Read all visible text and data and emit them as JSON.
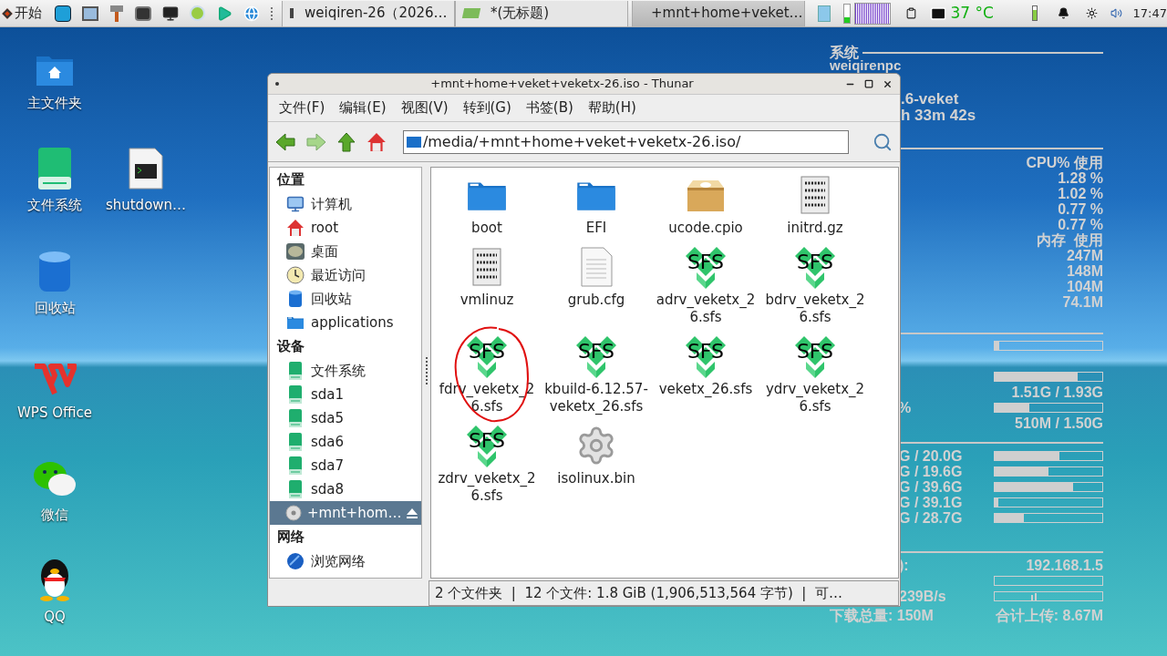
{
  "taskbar": {
    "start": {
      "label": "开始"
    },
    "tasks": [
      {
        "label": "weiqiren-26（2026…",
        "kind": "terminal",
        "selected": false
      },
      {
        "label": "*(无标题)",
        "kind": "editor",
        "selected": false
      },
      {
        "label": "+mnt+home+veket…",
        "kind": "filemanager",
        "selected": true
      }
    ],
    "temperature": "37 °C",
    "clock": "17:47"
  },
  "desktop_icons": [
    {
      "label": "主文件夹",
      "kind": "home"
    },
    {
      "label": "文件系统",
      "kind": "drive"
    },
    {
      "label": "shutdown…",
      "kind": "script"
    },
    {
      "label": "回收站",
      "kind": "trash"
    },
    {
      "label": "WPS Office",
      "kind": "wps"
    },
    {
      "label": "微信",
      "kind": "chat"
    },
    {
      "label": "QQ",
      "kind": "penguin"
    }
  ],
  "conky": {
    "header": "系统",
    "hostname": "weiqirenpc",
    "kernel": ".6-veket",
    "uptime": "h 33m 42s",
    "cpu_heading": "CPU% 使用",
    "cpu_values": [
      "1.28 %",
      "1.02 %",
      "0.77 %",
      "0.77 %"
    ],
    "mem_heading": "内存  使用",
    "mem_values": [
      "247M",
      "148M",
      "104M",
      "74.1M"
    ],
    "meters": [
      {
        "level": 0.04
      },
      {
        "level": 0.77,
        "reading": "1.51G / 1.93G"
      },
      {
        "label": "%",
        "level": 0.32,
        "reading": "510M / 1.50G"
      }
    ],
    "disks": [
      {
        "label": "G / 20.0G",
        "level": 0.6
      },
      {
        "label": "G / 19.6G",
        "level": 0.5
      },
      {
        "label": "G / 39.6G",
        "level": 0.73
      },
      {
        "label": "G / 39.1G",
        "level": 0.03
      },
      {
        "label": "G / 28.7G",
        "level": 0.27
      }
    ],
    "network": {
      "label": "):",
      "ip": "192.168.1.5",
      "speed": "239B/s",
      "download_total": "下载总量: 150M",
      "upload_total": "合计上传: 8.67M"
    }
  },
  "window": {
    "title": "+mnt+home+veket+veketx-26.iso - Thunar",
    "menu": [
      "文件(F)",
      "编辑(E)",
      "视图(V)",
      "转到(G)",
      "书签(B)",
      "帮助(H)"
    ],
    "location": "/media/+mnt+home+veket+veketx-26.iso/",
    "sidebar": [
      {
        "heading": "位置",
        "items": [
          {
            "label": "计算机",
            "kind": "computer",
            "selected": false
          },
          {
            "label": "root",
            "kind": "home",
            "selected": false
          },
          {
            "label": "桌面",
            "kind": "desktop",
            "selected": false
          },
          {
            "label": "最近访问",
            "kind": "recent",
            "selected": false
          },
          {
            "label": "回收站",
            "kind": "trash",
            "selected": false
          },
          {
            "label": "applications",
            "kind": "folder",
            "selected": false
          }
        ]
      },
      {
        "heading": "设备",
        "items": [
          {
            "label": "文件系统",
            "kind": "drive",
            "selected": false
          },
          {
            "label": "sda1",
            "kind": "drive",
            "selected": false
          },
          {
            "label": "sda5",
            "kind": "drive",
            "selected": false
          },
          {
            "label": "sda6",
            "kind": "drive",
            "selected": false
          },
          {
            "label": "sda7",
            "kind": "drive",
            "selected": false
          },
          {
            "label": "sda8",
            "kind": "drive",
            "selected": false
          },
          {
            "label": "+mnt+hom…",
            "kind": "disc",
            "selected": true
          }
        ]
      },
      {
        "heading": "网络",
        "items": [
          {
            "label": "浏览网络",
            "kind": "network",
            "selected": false
          }
        ]
      }
    ],
    "files": [
      {
        "name": "boot",
        "kind": "folder"
      },
      {
        "name": "EFI",
        "kind": "folder"
      },
      {
        "name": "ucode.cpio",
        "kind": "package"
      },
      {
        "name": "initrd.gz",
        "kind": "binary"
      },
      {
        "name": "vmlinuz",
        "kind": "binary"
      },
      {
        "name": "grub.cfg",
        "kind": "text"
      },
      {
        "name": "adrv_veketx_26.sfs",
        "kind": "sfs",
        "badge": "SFS"
      },
      {
        "name": "bdrv_veketx_26.sfs",
        "kind": "sfs",
        "badge": "SFS"
      },
      {
        "name": "fdrv_veketx_26.sfs",
        "kind": "sfs",
        "badge": "SFS",
        "circled": true
      },
      {
        "name": "kbuild-6.12.57-veketx_26.sfs",
        "kind": "sfs",
        "badge": "SFS"
      },
      {
        "name": "veketx_26.sfs",
        "kind": "sfs",
        "badge": "SFS"
      },
      {
        "name": "ydrv_veketx_26.sfs",
        "kind": "sfs",
        "badge": "SFS"
      },
      {
        "name": "zdrv_veketx_26.sfs",
        "kind": "sfs",
        "badge": "SFS"
      },
      {
        "name": "isolinux.bin",
        "kind": "gear"
      }
    ],
    "status": "2 个文件夹  |  12 个文件: 1.8 GiB (1,906,513,564 字节)  |  可…"
  }
}
